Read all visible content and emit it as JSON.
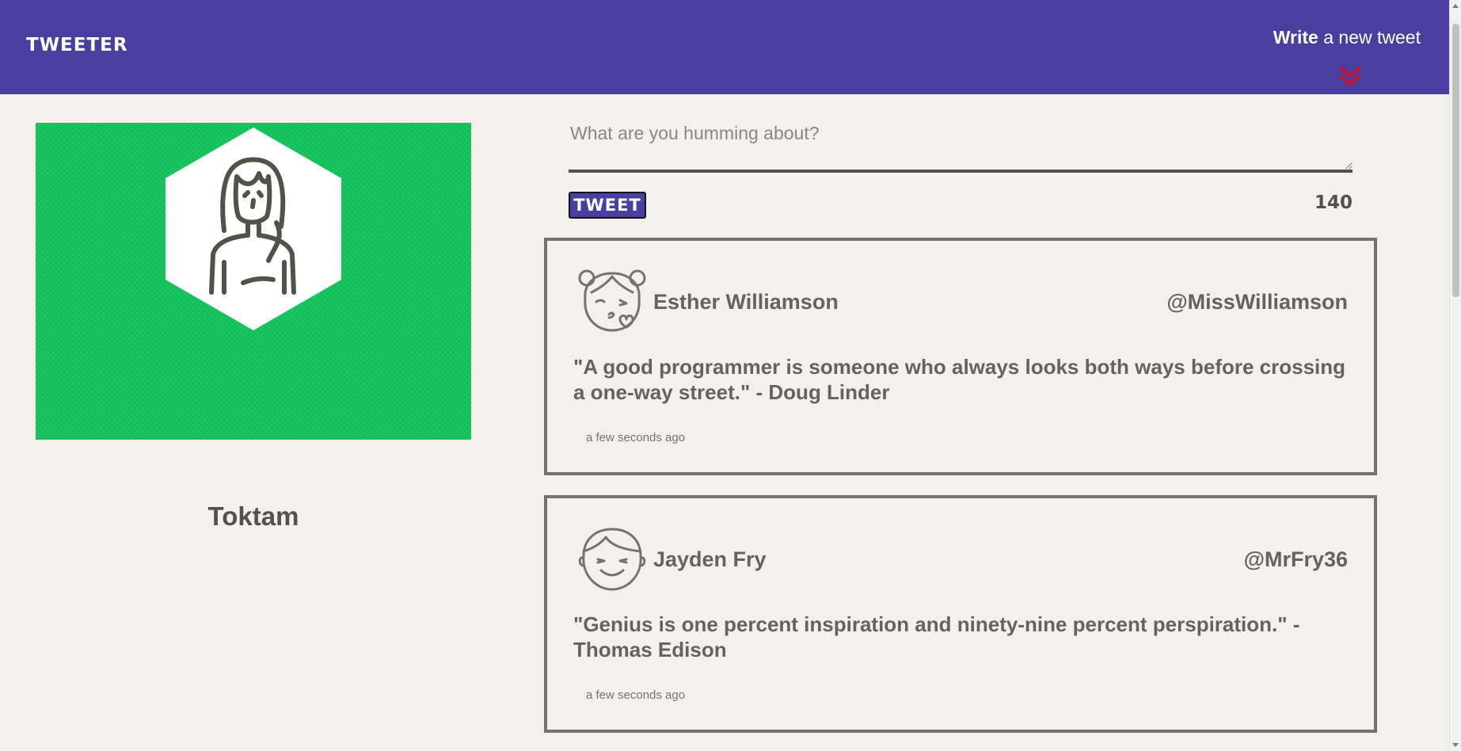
{
  "navbar": {
    "brand": "TWEETER",
    "compose_toggle_bold": "Write",
    "compose_toggle_rest": "a new tweet",
    "chevron_color": "#c8102e",
    "background": "#4a3ea0"
  },
  "profile": {
    "name": "Toktam",
    "avatar_icon": "woman-avatar-icon",
    "background": "#14c45c"
  },
  "compose": {
    "placeholder": "What are you humming about?",
    "value": "",
    "button_label": "TWEET",
    "char_count": "140"
  },
  "tweets": [
    {
      "name": "Esther Williamson",
      "handle": "@MissWilliamson",
      "avatar_icon": "girl-blowing-kiss-avatar-icon",
      "content": "\"A good programmer is someone who always looks both ways before crossing a one-way street.\" - Doug Linder",
      "time": "a few seconds ago"
    },
    {
      "name": "Jayden Fry",
      "handle": "@MrFry36",
      "avatar_icon": "boy-smiling-avatar-icon",
      "content": "\"Genius is one percent inspiration and ninety-nine percent perspiration.\" - Thomas Edison",
      "time": "a few seconds ago"
    }
  ]
}
